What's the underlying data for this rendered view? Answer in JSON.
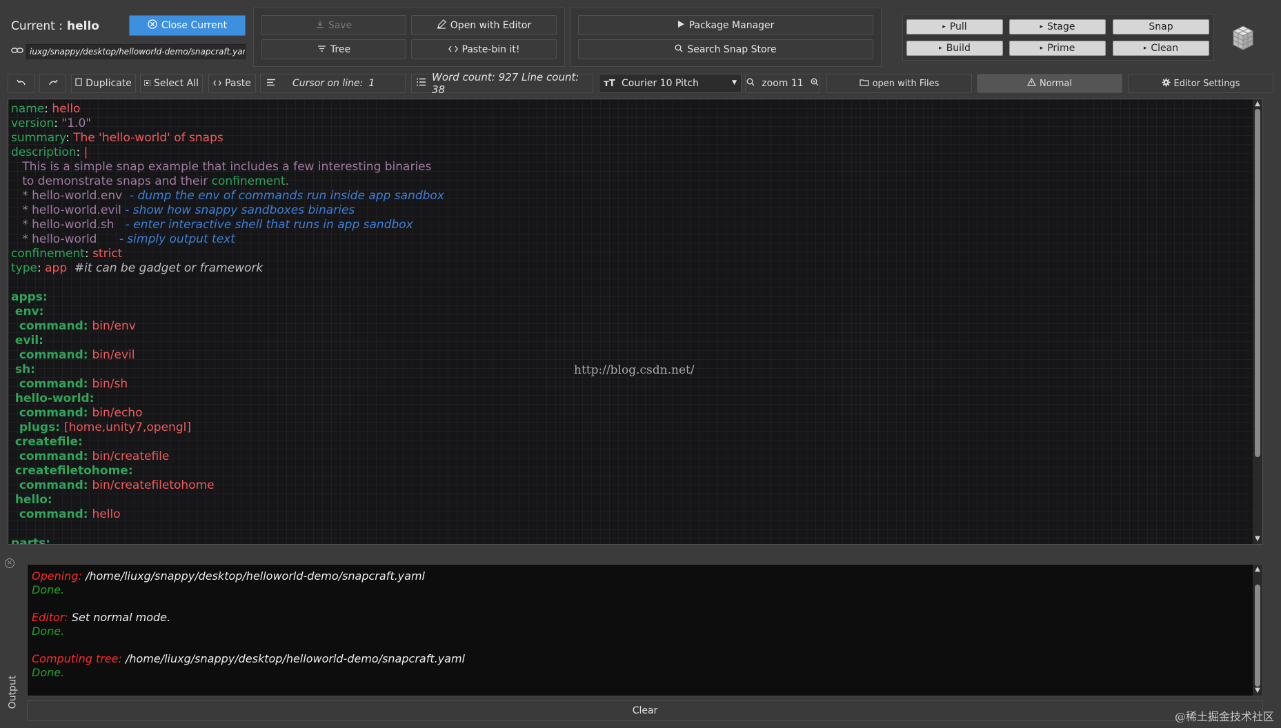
{
  "header": {
    "current_label": "Current :",
    "current_name": "hello",
    "close_label": "Close Current",
    "path": "iuxg/snappy/desktop/helloworld-demo/snapcraft.yaml"
  },
  "file_group": {
    "save_label": "Save",
    "open_editor_label": "Open with Editor",
    "tree_label": "Tree",
    "pastebin_label": "Paste-bin it!"
  },
  "store_group": {
    "package_manager_label": "Package Manager",
    "search_store_label": "Search Snap Store"
  },
  "build_group": {
    "pull": "Pull",
    "stage": "Stage",
    "snap": "Snap",
    "build": "Build",
    "prime": "Prime",
    "clean": "Clean"
  },
  "toolbar": {
    "duplicate": "Duplicate",
    "select_all": "Select All",
    "paste": "Paste",
    "cursor_label": "Cursor on line:",
    "cursor_line": "1",
    "word_count": "Word count: 927 Line count: 38",
    "font_name": "Courier 10 Pitch",
    "zoom_label": "zoom 11",
    "open_files": "open with Files",
    "mode": "Normal",
    "editor_settings": "Editor Settings"
  },
  "editor": {
    "watermark": "http://blog.csdn.net/",
    "lines": [
      [
        [
          "k",
          "name"
        ],
        [
          "w",
          ": "
        ],
        [
          "v",
          "hello"
        ]
      ],
      [
        [
          "k",
          "version"
        ],
        [
          "w",
          ": "
        ],
        [
          "d",
          "\"1.0\""
        ]
      ],
      [
        [
          "k",
          "summary"
        ],
        [
          "w",
          ": "
        ],
        [
          "v",
          "The 'hello-world' of snaps"
        ]
      ],
      [
        [
          "k",
          "description"
        ],
        [
          "w",
          ": "
        ],
        [
          "v",
          "|"
        ]
      ],
      [
        [
          "d",
          "   This is a simple snap example that includes a few interesting binaries"
        ]
      ],
      [
        [
          "d",
          "   to demonstrate snaps and their "
        ],
        [
          "k",
          "confinement"
        ],
        [
          "d",
          "."
        ]
      ],
      [
        [
          "d",
          "   * hello-world.env  "
        ],
        [
          "c",
          "- dump the env of commands run inside app sandbox"
        ]
      ],
      [
        [
          "d",
          "   * hello-world.evil "
        ],
        [
          "c",
          "- show how snappy sandboxes binaries"
        ]
      ],
      [
        [
          "d",
          "   * hello-world.sh   "
        ],
        [
          "c",
          "- enter interactive shell that runs in app sandbox"
        ]
      ],
      [
        [
          "d",
          "   * hello-world      "
        ],
        [
          "c",
          "- simply output text"
        ]
      ],
      [
        [
          "k",
          "confinement"
        ],
        [
          "w",
          ": "
        ],
        [
          "v",
          "strict"
        ]
      ],
      [
        [
          "k",
          "type"
        ],
        [
          "w",
          ": "
        ],
        [
          "v",
          "app"
        ],
        [
          "cm",
          "  #it can be gadget or framework"
        ]
      ],
      [],
      [
        [
          "kb",
          "apps:"
        ]
      ],
      [
        [
          "kb",
          " env:"
        ]
      ],
      [
        [
          "kb",
          "  command: "
        ],
        [
          "v",
          "bin/env"
        ]
      ],
      [
        [
          "kb",
          " evil:"
        ]
      ],
      [
        [
          "kb",
          "  command: "
        ],
        [
          "v",
          "bin/evil"
        ]
      ],
      [
        [
          "kb",
          " sh:"
        ]
      ],
      [
        [
          "kb",
          "  command: "
        ],
        [
          "v",
          "bin/sh"
        ]
      ],
      [
        [
          "kb",
          " hello-world:"
        ]
      ],
      [
        [
          "kb",
          "  command: "
        ],
        [
          "v",
          "bin/echo"
        ]
      ],
      [
        [
          "kb",
          "  plugs: "
        ],
        [
          "v",
          "[home,unity7,opengl]"
        ]
      ],
      [
        [
          "kb",
          " createfile:"
        ]
      ],
      [
        [
          "kb",
          "  command: "
        ],
        [
          "v",
          "bin/createfile"
        ]
      ],
      [
        [
          "kb",
          " createfiletohome:"
        ]
      ],
      [
        [
          "kb",
          "  command: "
        ],
        [
          "v",
          "bin/createfiletohome"
        ]
      ],
      [
        [
          "kb",
          " hello:"
        ]
      ],
      [
        [
          "kb",
          "  command: "
        ],
        [
          "v",
          "hello"
        ]
      ],
      [],
      [
        [
          "kb",
          "parts:"
        ]
      ]
    ]
  },
  "output": {
    "side_label": "Output",
    "lines": [
      [
        [
          "lr",
          "Opening: "
        ],
        [
          "lw",
          "/home/liuxg/snappy/desktop/helloworld-demo/snapcraft.yaml"
        ]
      ],
      [
        [
          "lg",
          "Done."
        ]
      ],
      [],
      [
        [
          "lr",
          "Editor: "
        ],
        [
          "lw",
          "Set normal mode."
        ]
      ],
      [
        [
          "lg",
          "Done."
        ]
      ],
      [],
      [
        [
          "lr",
          "Computing tree: "
        ],
        [
          "lw",
          "/home/liuxg/snappy/desktop/helloworld-demo/snapcraft.yaml"
        ]
      ],
      [
        [
          "lg",
          "Done."
        ]
      ]
    ],
    "clear_label": "Clear"
  },
  "corner_mark": "@稀土掘金技术社区"
}
